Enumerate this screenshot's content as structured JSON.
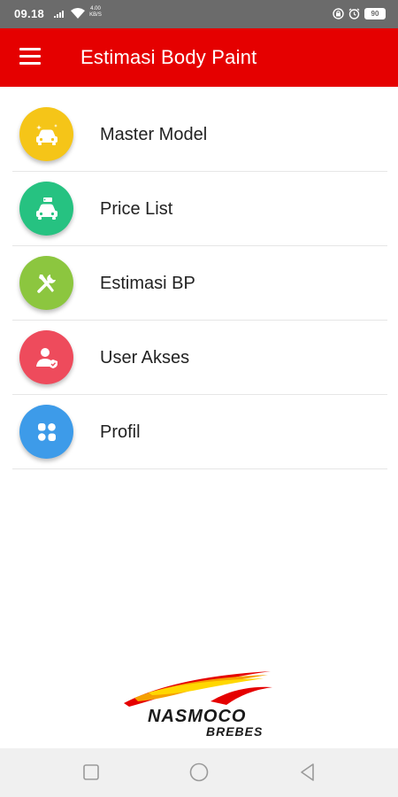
{
  "status_bar": {
    "time": "09.18",
    "speed_value": "4.00",
    "speed_unit": "KB/S",
    "battery": "90",
    "icons": [
      "signal-icon",
      "wifi-icon",
      "lock-icon",
      "alarm-icon",
      "battery-icon"
    ]
  },
  "app_bar": {
    "title": "Estimasi Body Paint",
    "menu_icon": "hamburger-menu-icon"
  },
  "menu": {
    "items": [
      {
        "label": "Master Model",
        "icon": "car-sparkle-icon",
        "color": "#f5c518"
      },
      {
        "label": "Price List",
        "icon": "car-tag-icon",
        "color": "#26c281"
      },
      {
        "label": "Estimasi BP",
        "icon": "tools-icon",
        "color": "#8cc63f"
      },
      {
        "label": "User Akses",
        "icon": "user-access-icon",
        "color": "#ee4b5c"
      },
      {
        "label": "Profil",
        "icon": "apps-grid-icon",
        "color": "#3d9be9"
      }
    ]
  },
  "logo": {
    "line1": "NASMOCO",
    "line2": "BREBES",
    "colors": [
      "#e50000",
      "#f5a000",
      "#ffd700"
    ]
  },
  "nav_bar": {
    "buttons": [
      "recent-apps-icon",
      "home-icon",
      "back-icon"
    ]
  },
  "theme": {
    "primary": "#e50000",
    "status_bar": "#6b6b6b",
    "nav_bar": "#f0f0f0"
  }
}
